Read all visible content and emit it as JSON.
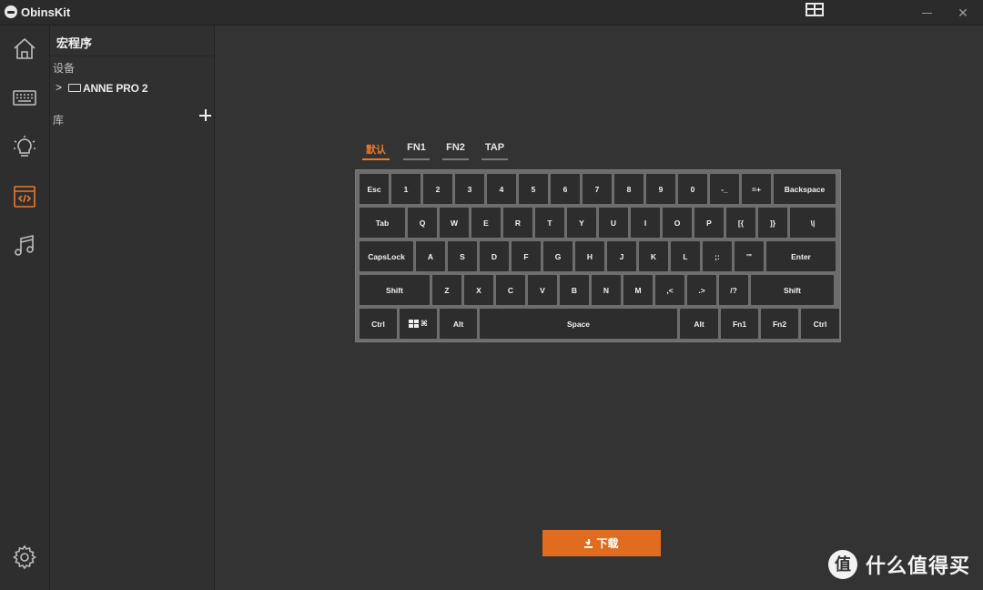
{
  "window": {
    "title": "ObinsKit"
  },
  "sidebar": {
    "items": [
      {
        "name": "home",
        "icon": "home-icon"
      },
      {
        "name": "keyboard",
        "icon": "keyboard-icon"
      },
      {
        "name": "lighting",
        "icon": "lightbulb-icon"
      },
      {
        "name": "macro",
        "icon": "code-icon",
        "active": true
      },
      {
        "name": "music",
        "icon": "music-note-icon"
      }
    ],
    "settings_icon": "gear-icon"
  },
  "panel": {
    "title": "宏程序",
    "devices_label": "设备",
    "device_name": "ANNE PRO 2",
    "library_label": "库"
  },
  "tabs": [
    {
      "label": "默认",
      "active": true
    },
    {
      "label": "FN1",
      "active": false
    },
    {
      "label": "FN2",
      "active": false
    },
    {
      "label": "TAP",
      "active": false
    }
  ],
  "keyboard": {
    "rows": [
      [
        "Esc",
        "1",
        "2",
        "3",
        "4",
        "5",
        "6",
        "7",
        "8",
        "9",
        "0",
        "-_",
        "=+",
        "Backspace"
      ],
      [
        "Tab",
        "Q",
        "W",
        "E",
        "R",
        "T",
        "Y",
        "U",
        "I",
        "O",
        "P",
        "[{",
        "]}",
        "\\|"
      ],
      [
        "CapsLock",
        "A",
        "S",
        "D",
        "F",
        "G",
        "H",
        "J",
        "K",
        "L",
        ";:",
        "'\"",
        "Enter"
      ],
      [
        "Shift",
        "Z",
        "X",
        "C",
        "V",
        "B",
        "N",
        "M",
        ",<",
        ".>",
        "/?",
        "Shift"
      ],
      [
        "Ctrl",
        "⌘",
        "Alt",
        "Space",
        "Alt",
        "Fn1",
        "Fn2",
        "Ctrl"
      ]
    ]
  },
  "download_button": {
    "label": "下载"
  },
  "watermark": {
    "text": "什么值得买"
  },
  "colors": {
    "accent": "#e8792b",
    "background": "#333333",
    "key": "#2d2d2d",
    "keyboard_frame": "#6d6d6d"
  }
}
